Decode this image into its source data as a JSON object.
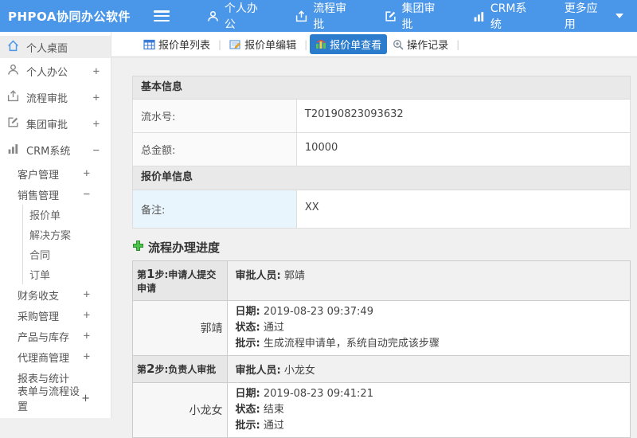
{
  "topbar": {
    "logo": "PHPOA协同办公软件",
    "nav": [
      {
        "label": "个人办公",
        "icon": "user-icon"
      },
      {
        "label": "流程审批",
        "icon": "flow-icon"
      },
      {
        "label": "集团审批",
        "icon": "edit-icon"
      },
      {
        "label": "CRM系统",
        "icon": "chart-icon"
      },
      {
        "label": "更多应用",
        "icon": "caret-down-icon"
      }
    ]
  },
  "sidebar": {
    "items": [
      {
        "label": "个人桌面"
      },
      {
        "label": "个人办公",
        "toggle": "+"
      },
      {
        "label": "流程审批",
        "toggle": "+"
      },
      {
        "label": "集团审批",
        "toggle": "+"
      },
      {
        "label": "CRM系统",
        "toggle": "−"
      },
      {
        "label": "客户管理",
        "toggle": "+"
      },
      {
        "label": "销售管理",
        "toggle": "−"
      },
      {
        "label": "报价单"
      },
      {
        "label": "解决方案"
      },
      {
        "label": "合同"
      },
      {
        "label": "订单"
      },
      {
        "label": "财务收支",
        "toggle": "+"
      },
      {
        "label": "采购管理",
        "toggle": "+"
      },
      {
        "label": "产品与库存",
        "toggle": "+"
      },
      {
        "label": "代理商管理",
        "toggle": "+"
      },
      {
        "label": "报表与统计"
      },
      {
        "label": "表单与流程设置",
        "toggle": "+"
      }
    ]
  },
  "tabs": [
    {
      "label": "报价单列表"
    },
    {
      "label": "报价单编辑"
    },
    {
      "label": "报价单查看",
      "active": true
    },
    {
      "label": "操作记录"
    }
  ],
  "form": {
    "section1_title": "基本信息",
    "rows1": [
      {
        "label": "流水号:",
        "value": "T20190823093632"
      },
      {
        "label": "总金额:",
        "value": "10000"
      }
    ],
    "section2_title": "报价单信息",
    "rows2": [
      {
        "label": "备注:",
        "value": "XX"
      }
    ]
  },
  "progress": {
    "title": "流程办理进度",
    "approver_label": "审批人员:",
    "date_label": "日期:",
    "status_label": "状态:",
    "comment_label": "批示:",
    "steps": [
      {
        "step_prefix": "第",
        "step_num": "1",
        "step_suffix": "步:申请人提交申请",
        "approver": "郭靖",
        "name": "郭靖",
        "date": "2019-08-23 09:37:49",
        "status": "通过",
        "comment": "生成流程申请单，系统自动完成该步骤"
      },
      {
        "step_prefix": "第",
        "step_num": "2",
        "step_suffix": "步:负责人审批",
        "approver": "小龙女",
        "name": "小龙女",
        "date": "2019-08-23 09:41:21",
        "status": "结束",
        "comment": "通过"
      }
    ]
  },
  "colors": {
    "topbar_blue": "#4a96e8",
    "active_tab_blue": "#2b7ccd",
    "plus_green": "#3db03d"
  }
}
